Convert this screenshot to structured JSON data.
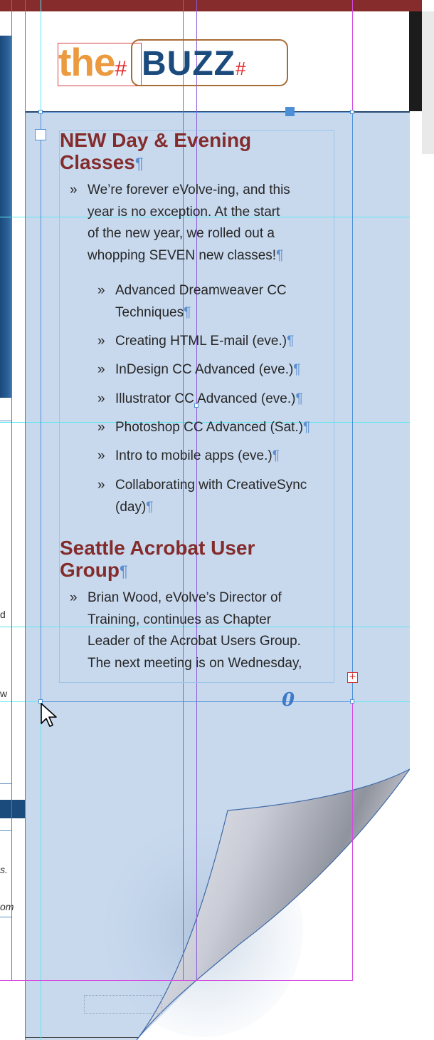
{
  "logo": {
    "the": "the",
    "buzz": "BUZZ",
    "hash_marks": [
      "#",
      "#"
    ]
  },
  "article1": {
    "heading_line1": "NEW Day & Evening",
    "heading_line2": "Classes",
    "intro_lines": [
      "We’re forever eVolve-ing, and this",
      "year is no exception. At the start",
      "of the new year, we rolled out a",
      "whopping SEVEN new classes!"
    ],
    "classes": [
      {
        "line1": "Advanced Dreamweaver CC",
        "line2": "Techniques"
      },
      {
        "line1": "Creating HTML E-mail (eve.)",
        "line2": ""
      },
      {
        "line1": "InDesign CC Advanced (eve.)",
        "line2": ""
      },
      {
        "line1": "Illustrator CC Advanced (eve.)",
        "line2": ""
      },
      {
        "line1": "Photoshop CC Advanced (Sat.)",
        "line2": ""
      },
      {
        "line1": "Intro to mobile apps (eve.)",
        "line2": ""
      },
      {
        "line1": "Collaborating with CreativeSync",
        "line2": "(day)"
      }
    ]
  },
  "article2": {
    "heading_line1": "Seattle Acrobat User",
    "heading_line2": "Group",
    "body_lines": [
      "Brian Wood, eVolve’s Director of",
      "Training, continues as Chapter",
      "Leader of the Acrobat Users Group.",
      "The next meeting is on Wednesday,"
    ]
  },
  "bullet_char": "»",
  "pilcrow": "¶",
  "overset_marker": "+",
  "link_marker": "0",
  "left_page_snippets": [
    "d",
    "w",
    "s.",
    "om"
  ],
  "colors": {
    "heading": "#842c2c",
    "logo_orange": "#ec9a3f",
    "logo_blue": "#1b4a7c",
    "panel": "#c8d9ee",
    "guide_cyan": "#5ee7f0",
    "guide_purple": "#8a5bd6",
    "margin_magenta": "#d44ae0"
  }
}
